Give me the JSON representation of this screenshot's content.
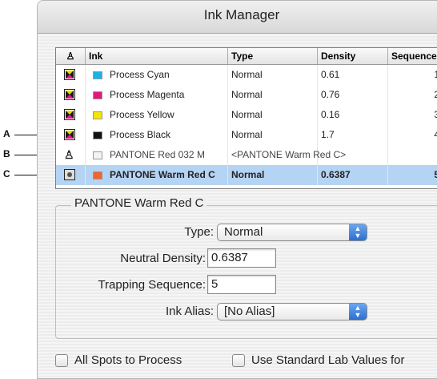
{
  "window": {
    "title": "Ink Manager"
  },
  "table": {
    "headers": [
      "Ink",
      "Type",
      "Density",
      "Sequence"
    ],
    "rows": [
      {
        "icon": "process-ink-icon",
        "swatch": "#18b4e8",
        "ink": "Process Cyan",
        "type": "Normal",
        "density": "0.61",
        "sequence": "1"
      },
      {
        "icon": "process-ink-icon",
        "swatch": "#e0197a",
        "ink": "Process Magenta",
        "type": "Normal",
        "density": "0.76",
        "sequence": "2"
      },
      {
        "icon": "process-ink-icon",
        "swatch": "#f5e600",
        "ink": "Process Yellow",
        "type": "Normal",
        "density": "0.16",
        "sequence": "3"
      },
      {
        "icon": "process-ink-icon",
        "swatch": "#111111",
        "ink": "Process Black",
        "type": "Normal",
        "density": "1.7",
        "sequence": "4"
      },
      {
        "icon": "ink-alias-icon",
        "swatch": "#f3f3f3",
        "ink": "PANTONE Red 032 M",
        "type": "<PANTONE Warm Red C>",
        "density": "",
        "sequence": ""
      },
      {
        "icon": "spot-ink-icon",
        "swatch": "#f0642d",
        "ink": "PANTONE Warm Red C",
        "type": "Normal",
        "density": "0.6387",
        "sequence": "5"
      }
    ]
  },
  "callouts": {
    "a": "A",
    "b": "B",
    "c": "C"
  },
  "details": {
    "group_title": "PANTONE Warm Red C",
    "type_label": "Type:",
    "type_value": "Normal",
    "density_label": "Neutral Density:",
    "density_value": "0.6387",
    "trap_label": "Trapping Sequence:",
    "trap_value": "5",
    "alias_label": "Ink Alias:",
    "alias_value": "[No Alias]"
  },
  "options": {
    "spots_label": "All Spots to Process",
    "lab_label": "Use Standard Lab Values for"
  },
  "colors": {
    "selection": "#b5d3f3",
    "popup_arrow": "#2d6fd0"
  }
}
